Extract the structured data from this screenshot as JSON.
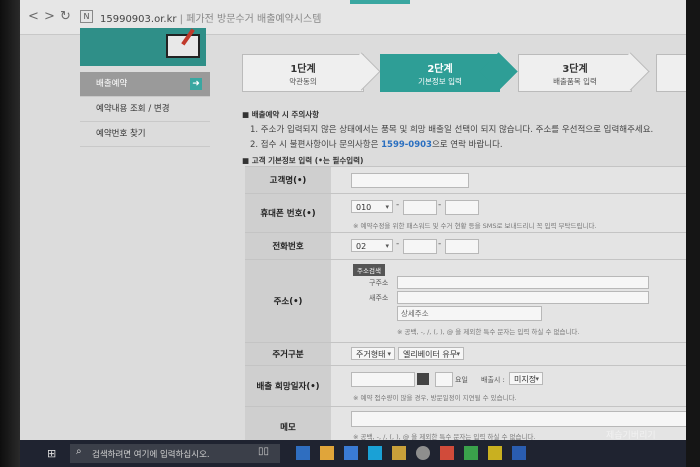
{
  "browser": {
    "back": "<",
    "forward": ">",
    "reload": "↻",
    "favicon": "N",
    "url_domain": "15990903.or.kr",
    "url_title": "페가전 방문수거 배출예약시스템"
  },
  "sidebar": {
    "items": [
      {
        "label": "배출예약",
        "active": true
      },
      {
        "label": "예약내용 조회 / 변경",
        "active": false
      },
      {
        "label": "예약번호 찾기",
        "active": false
      }
    ]
  },
  "steps": [
    {
      "num": "1단계",
      "name": "약관동의",
      "active": false
    },
    {
      "num": "2단계",
      "name": "기본정보 입력",
      "active": true
    },
    {
      "num": "3단계",
      "name": "배출품목 입력",
      "active": false
    }
  ],
  "notice": {
    "title": "■ 배출예약 시 주의사항",
    "line1": "1. 주소가 입력되지 않은 상태에서는 품목 및 희망 배출일 선택이 되지 않습니다. 주소를 우선적으로 입력해주세요.",
    "line2_pre": "2. 접수 시 불편사항이나 문의사항은 ",
    "line2_phone": "1599-0903",
    "line2_post": "으로 연락 바랍니다."
  },
  "section_title": "■ 고객 기본정보 입력 (•는 필수입력)",
  "form": {
    "name_label": "고객명(•)",
    "mobile_label": "휴대폰 번호(•)",
    "mobile_prefix": "010",
    "mobile_hint": "※ 예약수정을 위한 패스워드 및 수거 현황 등을 SMS로 보내드리니 꼭 입력 부탁드립니다.",
    "phone_label": "전화번호",
    "phone_prefix": "02",
    "address_label": "주소(•)",
    "address_search_btn": "주소검색",
    "old_addr_label": "구주소",
    "new_addr_label": "새주소",
    "detail_addr_placeholder": "상세주소",
    "address_hint": "※ 공백, -, /, (, ), @ 을 제외한 특수 문자는 입력 하실 수 없습니다.",
    "housing_label": "주거구분",
    "housing_type": "주거형태",
    "elevator": "엘리베이터 유무",
    "date_label": "배출 희망일자(•)",
    "weekday_suffix": "요일",
    "time_label": "배출시 :",
    "time_value": "미지정",
    "date_hint": "※ 예약 접수량이 많을 경우, 방문일정이 지연될 수 있습니다.",
    "memo_label": "메모",
    "memo_hint": "※ 공백, -, /, (, ), @ 을 제외한 특수 문자는 입력 하실 수 없습니다."
  },
  "taskbar": {
    "search_placeholder": "검색하려면 여기에 입력하십시오."
  },
  "watermark": "제습기버리기",
  "colors": {
    "accent": "#2e9e96",
    "phone": "#2a6fc0"
  }
}
